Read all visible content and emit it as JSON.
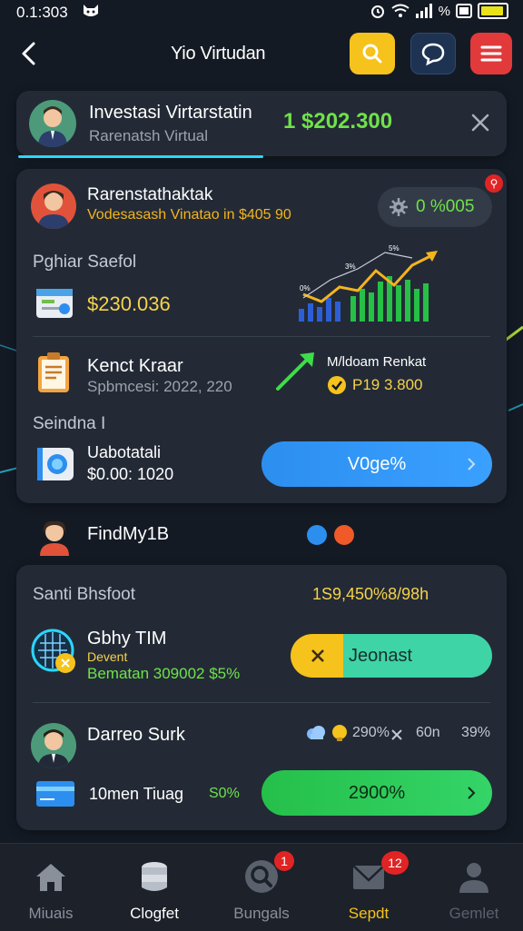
{
  "status_bar": {
    "time": "0.1:303",
    "battery_text": "%"
  },
  "header": {
    "title": "Yio Virtudan"
  },
  "top_card": {
    "title": "Investasi Virtarstatin",
    "subtitle": "Rarenatsh Virtual",
    "amount": "1 $202.300"
  },
  "main_card": {
    "name": "Rarenstathaktak",
    "subline": "Vodesasash Vinatao in $405 90",
    "badge_text": "0 %005",
    "section1_label": "Pghiar Saefol",
    "chart_labels": [
      "0%",
      "3%",
      "5%"
    ],
    "amount1": "$230.036",
    "item2_title": "Kenct Kraar",
    "item2_sub": "Spbmcesi: 2022, 220",
    "trend_title": "M/ldoam Renkat",
    "trend_value": "P19 3.800",
    "section2_label": "Seindna I",
    "item3_title": "Uabotatali",
    "item3_sub": "$0.00: 1020",
    "action_button": "V0ge%"
  },
  "section_header": {
    "title": "FindMy1B"
  },
  "list_card": {
    "header_left": "Santi Bhsfoot",
    "header_right": "1S9,450%8/98h",
    "row1_title": "Gbhy TIM",
    "row1_sub1": "Devent",
    "row1_sub2": "Bematan 309002 $5%",
    "row1_button": "Jeonast",
    "row2_title": "Darreo Surk",
    "row2_stats": [
      "290%",
      "60n",
      "39%"
    ],
    "row2_sub": "10men Tiuag",
    "row2_pct": "S0%",
    "row2_button": "2900%"
  },
  "bottom_nav": [
    {
      "label": "Miuais",
      "icon": "home-icon"
    },
    {
      "label": "Clogfet",
      "icon": "coin-stack-icon"
    },
    {
      "label": "Bungals",
      "icon": "search-circle-icon",
      "badge": "1"
    },
    {
      "label": "Sepdt",
      "icon": "mail-icon",
      "badge": "12"
    },
    {
      "label": "Gemlet",
      "icon": "user-icon"
    }
  ],
  "colors": {
    "accent_yellow": "#f6c21c",
    "accent_green": "#6fe24a",
    "accent_blue": "#2c8ff0",
    "accent_red": "#e23a3a",
    "bg": "#141a24",
    "card": "#232a36"
  }
}
